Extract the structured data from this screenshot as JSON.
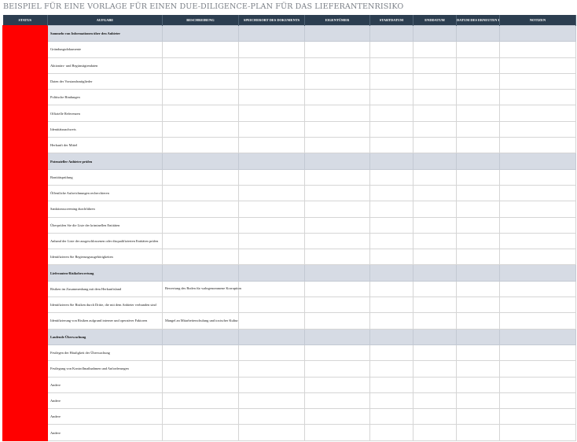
{
  "title": "BEISPIEL FÜR EINE VORLAGE FÜR EINEN DUE-DILIGENCE-PLAN FÜR DAS LIEFERANTENRISIKO",
  "columns": {
    "status": "STATUS",
    "task": "AUFGABE",
    "description": "BESCHREIBUNG",
    "location": "SPEICHERORT DES DOKUMENTS",
    "owner": "EIGENTÜMER",
    "start": "STARTDATUM",
    "end": "ENDDATUM",
    "review": "DATUM DES ERNEUTEN BESUCHS",
    "notes": "NOTIZEN"
  },
  "rows": [
    {
      "type": "section",
      "task": "Sammeln von Informationen über den Anbieter",
      "description": ""
    },
    {
      "type": "item",
      "task": "Gründungsdokumente",
      "description": ""
    },
    {
      "type": "item",
      "task": "Aktionärs- und Begünstigtendaten",
      "description": ""
    },
    {
      "type": "item",
      "task": "Daten der Vorstandsmitglieder",
      "description": ""
    },
    {
      "type": "item",
      "task": "Politische Bindungen",
      "description": ""
    },
    {
      "type": "item",
      "task": "Offizielle Referenzen",
      "description": ""
    },
    {
      "type": "item",
      "task": "Identitätsnachweis",
      "description": ""
    },
    {
      "type": "item",
      "task": "Herkunft der Mittel",
      "description": ""
    },
    {
      "type": "section",
      "task": "Potenzieller Anbieter prüfen",
      "description": ""
    },
    {
      "type": "item",
      "task": "Bonitätsprüfung",
      "description": ""
    },
    {
      "type": "item",
      "task": "Öffentliche Aufzeichnungen recherchieren",
      "description": ""
    },
    {
      "type": "item",
      "task": "Sanktionsscreening durchführen",
      "description": ""
    },
    {
      "type": "item",
      "task": "Überprüfen Sie die Liste der kriminellen Entitäten",
      "description": ""
    },
    {
      "type": "item",
      "task": "Anhand der Liste der ausgeschlossenen oder disqualifizierten Entitäten prüfen",
      "description": ""
    },
    {
      "type": "item",
      "task": "Identifizieren Sie Regierungszugehörigkeiten",
      "description": ""
    },
    {
      "type": "section",
      "task": "Lieferanten-Risikobewertung",
      "description": ""
    },
    {
      "type": "item",
      "task": "Risiken im Zusammenhang mit dem Herkunftsland",
      "description": "Bewertung des Boden für wahrgenommene Korruption"
    },
    {
      "type": "item",
      "task": "Identifizieren Sie Risiken durch Dritte, die mit dem Anbieter verbunden sind",
      "description": ""
    },
    {
      "type": "item",
      "task": "Identifizierung von Risiken aufgrund interner und operativer Faktoren",
      "description": "Mangel an Mitarbeiterschulung und toxischer Kultur"
    },
    {
      "type": "section",
      "task": "Laufende Überwachung",
      "description": ""
    },
    {
      "type": "item",
      "task": "Festlegen der Häufigkeit der Überwachung",
      "description": ""
    },
    {
      "type": "item",
      "task": "Festlegung von Kontrollmaßnahmen und Anforderungen",
      "description": ""
    },
    {
      "type": "item",
      "task": "Andere",
      "description": ""
    },
    {
      "type": "item",
      "task": "Andere",
      "description": ""
    },
    {
      "type": "item",
      "task": "Andere",
      "description": ""
    },
    {
      "type": "item",
      "task": "Andere",
      "description": ""
    }
  ]
}
